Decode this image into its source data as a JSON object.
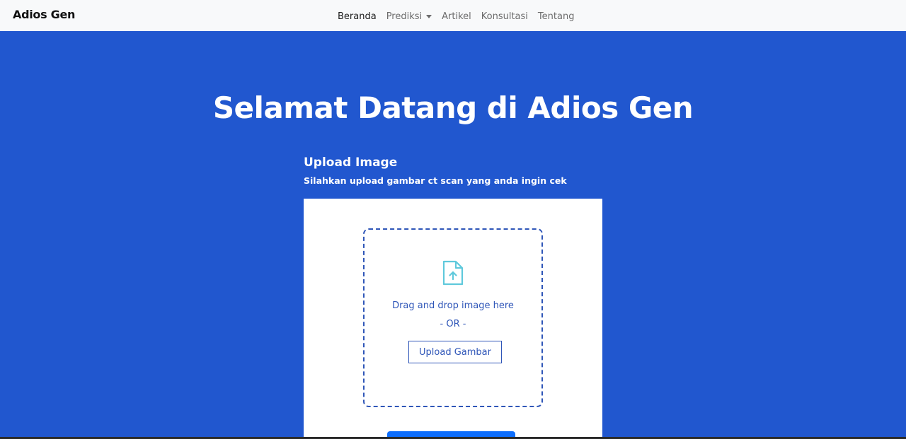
{
  "navbar": {
    "brand": "Adios Gen",
    "links": [
      {
        "label": "Beranda",
        "active": true
      },
      {
        "label": "Prediksi",
        "dropdown": true
      },
      {
        "label": "Artikel"
      },
      {
        "label": "Konsultasi"
      },
      {
        "label": "Tentang"
      }
    ]
  },
  "hero": {
    "title": "Selamat Datang di Adios Gen"
  },
  "upload": {
    "heading": "Upload Image",
    "subtitle": "Silahkan upload gambar ct scan yang anda ingin cek",
    "dropzone": {
      "icon": "file-upload-icon",
      "drag_text": "Drag and drop image here",
      "or_text": "- OR -",
      "button_label": "Upload Gambar"
    }
  },
  "colors": {
    "background": "#2157cf",
    "navbar": "#f8f9fa",
    "accent": "#2f56b8",
    "icon": "#5fc9dc",
    "primary_button": "#0d6efd"
  }
}
